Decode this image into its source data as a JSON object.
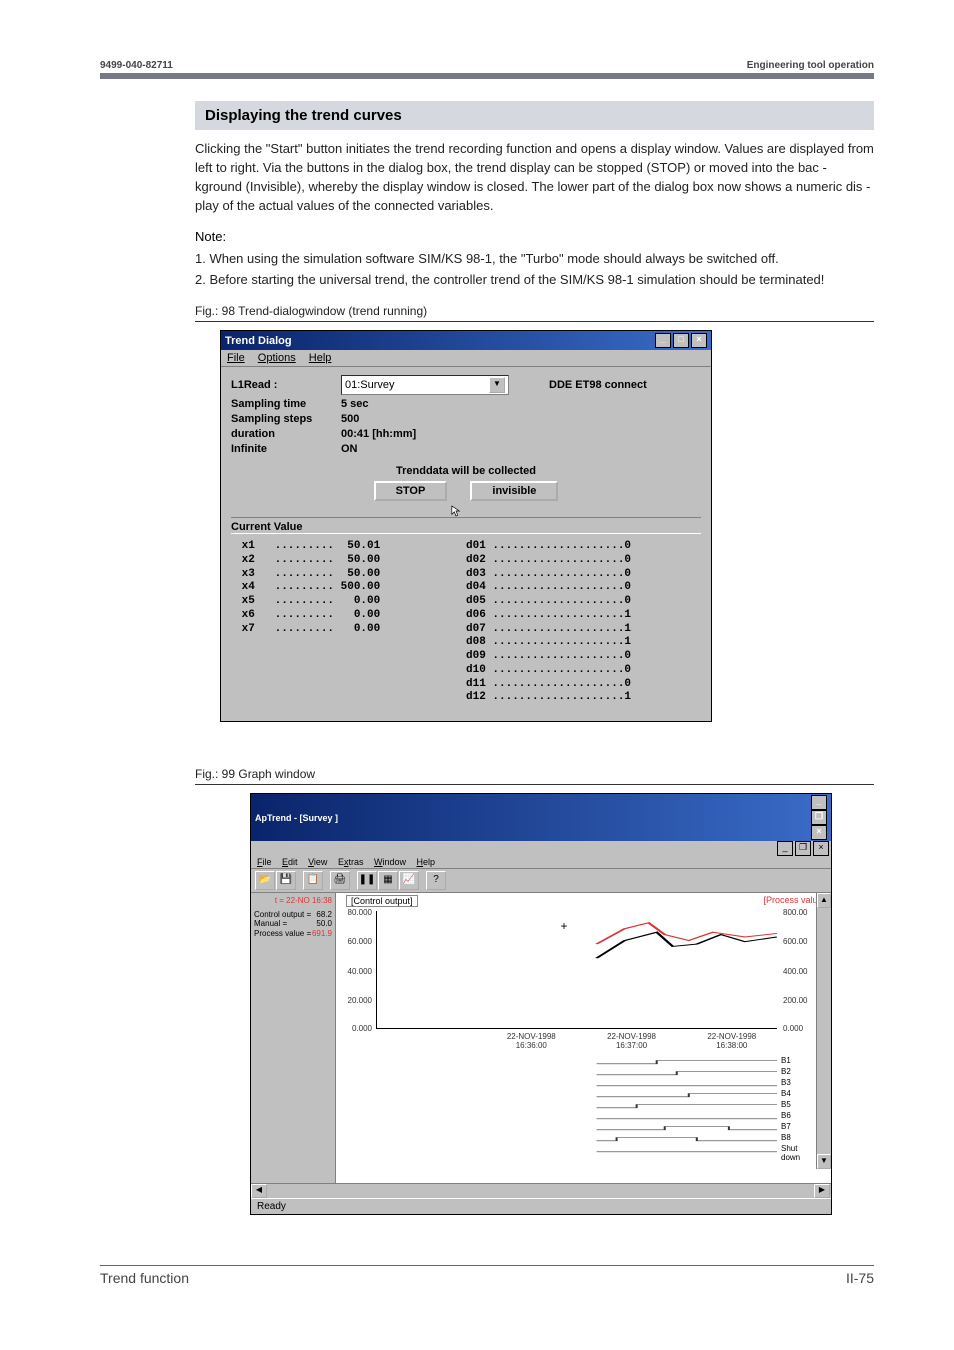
{
  "header": {
    "left": "9499-040-82711",
    "right": "Engineering tool operation"
  },
  "section_title": "Displaying the trend curves",
  "paragraph": "Clicking the \"Start\" button initiates the trend recording function and opens a display window. Values are displayed from left to right. Via the buttons in the dialog box, the trend display can be stopped (STOP) or moved into the bac - kground (Invisible), whereby the display window is closed. The lower part of the dialog box now shows a numeric dis - play of the actual values of the connected variables.",
  "note_label": "Note:",
  "notes": [
    "1. When using the simulation software SIM/KS 98-1, the \"Turbo\" mode should always be  switched off.",
    "2. Before starting the universal trend, the controller trend of the SIM/KS 98-1 simulation  should be terminated!"
  ],
  "fig98_caption": " Fig.: 98 Trend-dialogwindow (trend running)",
  "fig99_caption": " Fig.: 99 Graph window",
  "dialog": {
    "title": "Trend Dialog",
    "menu": {
      "file": "File",
      "options": "Options",
      "help": "Help"
    },
    "row_read_label": "L1Read :",
    "read_value": "01:Survey",
    "dde": "DDE ET98  connect",
    "sampling_time_label": "Sampling time",
    "sampling_time_value": "5 sec",
    "sampling_steps_label": "Sampling steps",
    "sampling_steps_value": "500",
    "duration_label": "duration",
    "duration_value": "00:41 [hh:mm]",
    "infinite_label": "Infinite",
    "infinite_value": "ON",
    "collect_note": "Trenddata will be collected",
    "stop_btn": "STOP",
    "invisible_btn": "invisible",
    "current_value_label": "Current Value",
    "x_values": [
      {
        "k": "x1",
        "v": "50.01"
      },
      {
        "k": "x2",
        "v": "50.00"
      },
      {
        "k": "x3",
        "v": "50.00"
      },
      {
        "k": "x4",
        "v": "500.00"
      },
      {
        "k": "x5",
        "v": "0.00"
      },
      {
        "k": "x6",
        "v": "0.00"
      },
      {
        "k": "x7",
        "v": "0.00"
      }
    ],
    "d_values": [
      {
        "k": "d01",
        "v": "0"
      },
      {
        "k": "d02",
        "v": "0"
      },
      {
        "k": "d03",
        "v": "0"
      },
      {
        "k": "d04",
        "v": "0"
      },
      {
        "k": "d05",
        "v": "0"
      },
      {
        "k": "d06",
        "v": "1"
      },
      {
        "k": "d07",
        "v": "1"
      },
      {
        "k": "d08",
        "v": "1"
      },
      {
        "k": "d09",
        "v": "0"
      },
      {
        "k": "d10",
        "v": "0"
      },
      {
        "k": "d11",
        "v": "0"
      },
      {
        "k": "d12",
        "v": "1"
      }
    ]
  },
  "graph": {
    "title": "ApTrend - [Survey      ]",
    "menu": {
      "file": "File",
      "edit": "Edit",
      "view": "View",
      "extras": "Extras",
      "window": "Window",
      "help": "Help"
    },
    "sidebar_time": "t = 22-NO\n16:38",
    "sidebar_rows": [
      {
        "lab": "Control output =",
        "val": "68.2"
      },
      {
        "lab": "Manual =",
        "val": "50.0"
      },
      {
        "lab": "Process value =",
        "val": "691.9",
        "red": true
      }
    ],
    "plot_top_label": "[Control output]",
    "plot_top_right": "[Process value]",
    "y_ticks_left": [
      "80.000",
      "60.000",
      "40.000",
      "20.000",
      "0.000"
    ],
    "y_ticks_right": [
      "800.00",
      "600.00",
      "400.00",
      "200.00",
      "0.000"
    ],
    "x_ticks": [
      {
        "l1": "22-NOV-1998",
        "l2": "16:36:00"
      },
      {
        "l1": "22-NOV-1998",
        "l2": "16:37:00"
      },
      {
        "l1": "22-NOV-1998",
        "l2": "16:38:00"
      }
    ],
    "d_labels": [
      "B1",
      "B2",
      "B3",
      "B4",
      "B5",
      "B6",
      "B7",
      "B8",
      "Shut down"
    ],
    "status": "Ready"
  },
  "footer": {
    "left": "Trend function",
    "right": "II-75"
  },
  "chart_data": {
    "type": "line",
    "title": "ApTrend - Survey",
    "x_range": [
      "22-NOV-1998 16:36:00",
      "22-NOV-1998 16:38:00"
    ],
    "series": [
      {
        "name": "Control output",
        "axis": "left",
        "ylim": [
          0,
          80
        ],
        "points_approx": [
          [
            0.55,
            50
          ],
          [
            0.7,
            68
          ],
          [
            0.8,
            62
          ],
          [
            0.9,
            65
          ],
          [
            1.0,
            68
          ]
        ]
      },
      {
        "name": "Process value",
        "axis": "right",
        "ylim": [
          0,
          800
        ],
        "points_approx": [
          [
            0.55,
            600
          ],
          [
            0.7,
            720
          ],
          [
            0.85,
            660
          ],
          [
            1.0,
            692
          ]
        ]
      }
    ],
    "digital_tracks": [
      "B1",
      "B2",
      "B3",
      "B4",
      "B5",
      "B6",
      "B7",
      "B8",
      "Shut down"
    ]
  }
}
